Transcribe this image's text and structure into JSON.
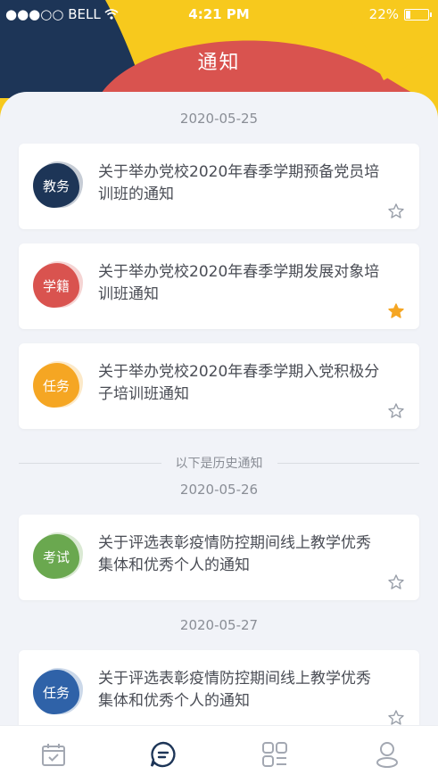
{
  "status_bar": {
    "carrier": "●●●○○ BELL",
    "time": "4:21 PM",
    "battery_text": "22%",
    "battery_level": 0.22
  },
  "header": {
    "title": "通知"
  },
  "colors": {
    "yellow": "#f7c91d",
    "navy": "#1d3557",
    "red": "#d9534f",
    "blue": "#2f62a8",
    "green": "#6aa84f",
    "orange": "#f5a623",
    "star_active": "#f5a623",
    "star_inactive": "#9aa0aa",
    "active_tab": "#1d3557",
    "inactive_tab": "#a3a8b2"
  },
  "groups": [
    {
      "date": "2020-05-25",
      "items": [
        {
          "tag": "教务",
          "tag_color": "#1d3557",
          "title": "关于举办党校2020年春季学期预备党员培训班的通知",
          "starred": false
        },
        {
          "tag": "学籍",
          "tag_color": "#d9534f",
          "title": "关于举办党校2020年春季学期发展对象培训班通知",
          "starred": true
        },
        {
          "tag": "任务",
          "tag_color": "#f5a623",
          "title": "关于举办党校2020年春季学期入党积极分子培训班通知",
          "starred": false
        }
      ]
    }
  ],
  "history_label": "以下是历史通知",
  "history_groups": [
    {
      "date": "2020-05-26",
      "items": [
        {
          "tag": "考试",
          "tag_color": "#6aa84f",
          "title": "关于评选表彰疫情防控期间线上教学优秀集体和优秀个人的通知",
          "starred": false
        }
      ]
    },
    {
      "date": "2020-05-27",
      "items": [
        {
          "tag": "任务",
          "tag_color": "#2f62a8",
          "title": "关于评选表彰疫情防控期间线上教学优秀集体和优秀个人的通知",
          "starred": false
        }
      ]
    }
  ],
  "tabbar": {
    "items": [
      {
        "icon": "calendar-icon",
        "active": false
      },
      {
        "icon": "message-icon",
        "active": true
      },
      {
        "icon": "apps-grid-icon",
        "active": false
      },
      {
        "icon": "user-icon",
        "active": false
      }
    ]
  }
}
